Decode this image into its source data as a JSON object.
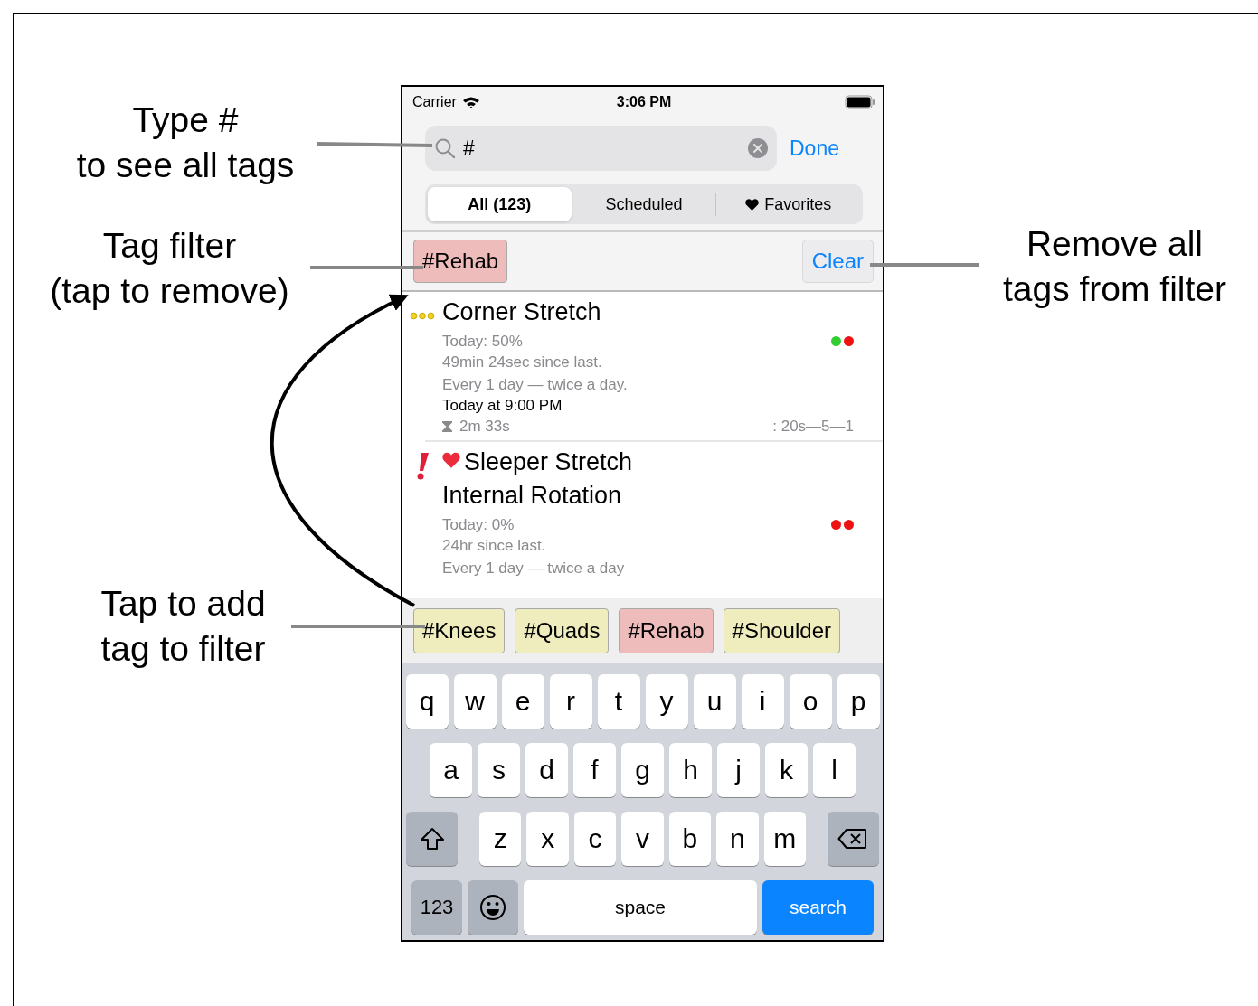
{
  "annotations": [
    {
      "lines": [
        "Type #",
        "to see all tags"
      ]
    },
    {
      "lines": [
        "Tag filter",
        "(tap to remove)"
      ]
    },
    {
      "lines": [
        "Tap to add",
        "tag to filter"
      ]
    },
    {
      "lines": [
        "Remove all",
        "tags from filter"
      ]
    }
  ],
  "status_bar": {
    "carrier": "Carrier",
    "time": "3:06 PM"
  },
  "search": {
    "value": "#",
    "done": "Done"
  },
  "segments": [
    {
      "label": "All (123)",
      "selected": true,
      "kind": "plain"
    },
    {
      "label": "Scheduled",
      "selected": false,
      "kind": "plain"
    },
    {
      "label": "Favorites",
      "selected": false,
      "kind": "heart"
    }
  ],
  "filter": {
    "tags": [
      {
        "label": "#Rehab",
        "color": "#efbcbc"
      }
    ],
    "clear": "Clear"
  },
  "exercises": [
    {
      "kind": "dots",
      "favorite": false,
      "title_lines": [
        "Corner Stretch"
      ],
      "today": "Today: 50%",
      "since": "49min 24sec since last.",
      "schedule": "Every 1 day  — twice a day.",
      "next": "Today at 9:00 PM",
      "duration": "2m 33s",
      "reps": ": 20s—5—1",
      "dots": [
        {
          "color": "#33cc33"
        },
        {
          "color": "#ee1111"
        }
      ]
    },
    {
      "kind": "alert",
      "favorite": true,
      "title_lines": [
        "Sleeper Stretch",
        "Internal Rotation"
      ],
      "today": "Today: 0%",
      "since": "24hr since last.",
      "schedule": "Every 1 day  — twice a day",
      "dots": [
        {
          "color": "#ee1111"
        },
        {
          "color": "#ee1111"
        }
      ]
    }
  ],
  "tag_suggestions": [
    {
      "label": "#Knees",
      "color": "#efedbd"
    },
    {
      "label": "#Quads",
      "color": "#efedbd"
    },
    {
      "label": "#Rehab",
      "color": "#efbcbc"
    },
    {
      "label": "#Shoulder",
      "color": "#efedbd"
    }
  ],
  "keyboard": {
    "rows": [
      [
        "q",
        "w",
        "e",
        "r",
        "t",
        "y",
        "u",
        "i",
        "o",
        "p"
      ],
      [
        "a",
        "s",
        "d",
        "f",
        "g",
        "h",
        "j",
        "k",
        "l"
      ],
      [
        "z",
        "x",
        "c",
        "v",
        "b",
        "n",
        "m"
      ]
    ],
    "numbers": "123",
    "space": "space",
    "action": "search"
  }
}
